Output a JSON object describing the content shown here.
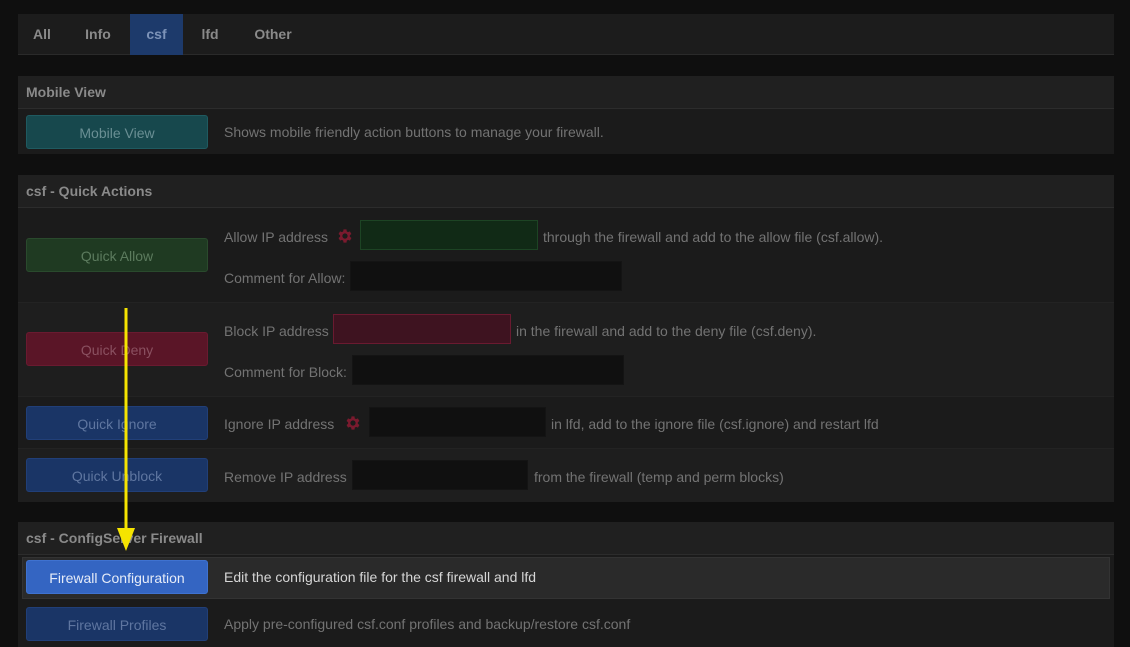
{
  "tabs": [
    {
      "label": "All",
      "active": false
    },
    {
      "label": "Info",
      "active": false
    },
    {
      "label": "csf",
      "active": true
    },
    {
      "label": "lfd",
      "active": false
    },
    {
      "label": "Other",
      "active": false
    }
  ],
  "mobile_view": {
    "title": "Mobile View",
    "button": "Mobile View",
    "description": "Shows mobile friendly action buttons to manage your firewall."
  },
  "quick_actions": {
    "title": "csf - Quick Actions",
    "allow": {
      "button": "Quick Allow",
      "ip_label": "Allow IP address",
      "ip_value": "",
      "ip_suffix": "through the firewall and add to the allow file (csf.allow).",
      "comment_label": "Comment for Allow:",
      "comment_value": ""
    },
    "deny": {
      "button": "Quick Deny",
      "ip_label": "Block IP address",
      "ip_value": "",
      "ip_suffix": "in the firewall and add to the deny file (csf.deny).",
      "comment_label": "Comment for Block:",
      "comment_value": ""
    },
    "ignore": {
      "button": "Quick Ignore",
      "ip_label": "Ignore IP address",
      "ip_value": "",
      "ip_suffix": "in lfd, add to the ignore file (csf.ignore) and restart lfd"
    },
    "unblock": {
      "button": "Quick Unblock",
      "ip_label": "Remove IP address",
      "ip_value": "",
      "ip_suffix": "from the firewall (temp and perm blocks)"
    }
  },
  "configserver": {
    "title": "csf - ConfigServer Firewall",
    "items": [
      {
        "button": "Firewall Configuration",
        "description": "Edit the configuration file for the csf firewall and lfd",
        "highlighted": true
      },
      {
        "button": "Firewall Profiles",
        "description": "Apply pre-configured csf.conf profiles and backup/restore csf.conf",
        "highlighted": false
      }
    ]
  },
  "colors": {
    "annotation_arrow": "#f5e400",
    "gear": "#7a1a2e"
  },
  "icons": {
    "gear": "gear-icon",
    "arrow": "arrow-down-icon"
  }
}
